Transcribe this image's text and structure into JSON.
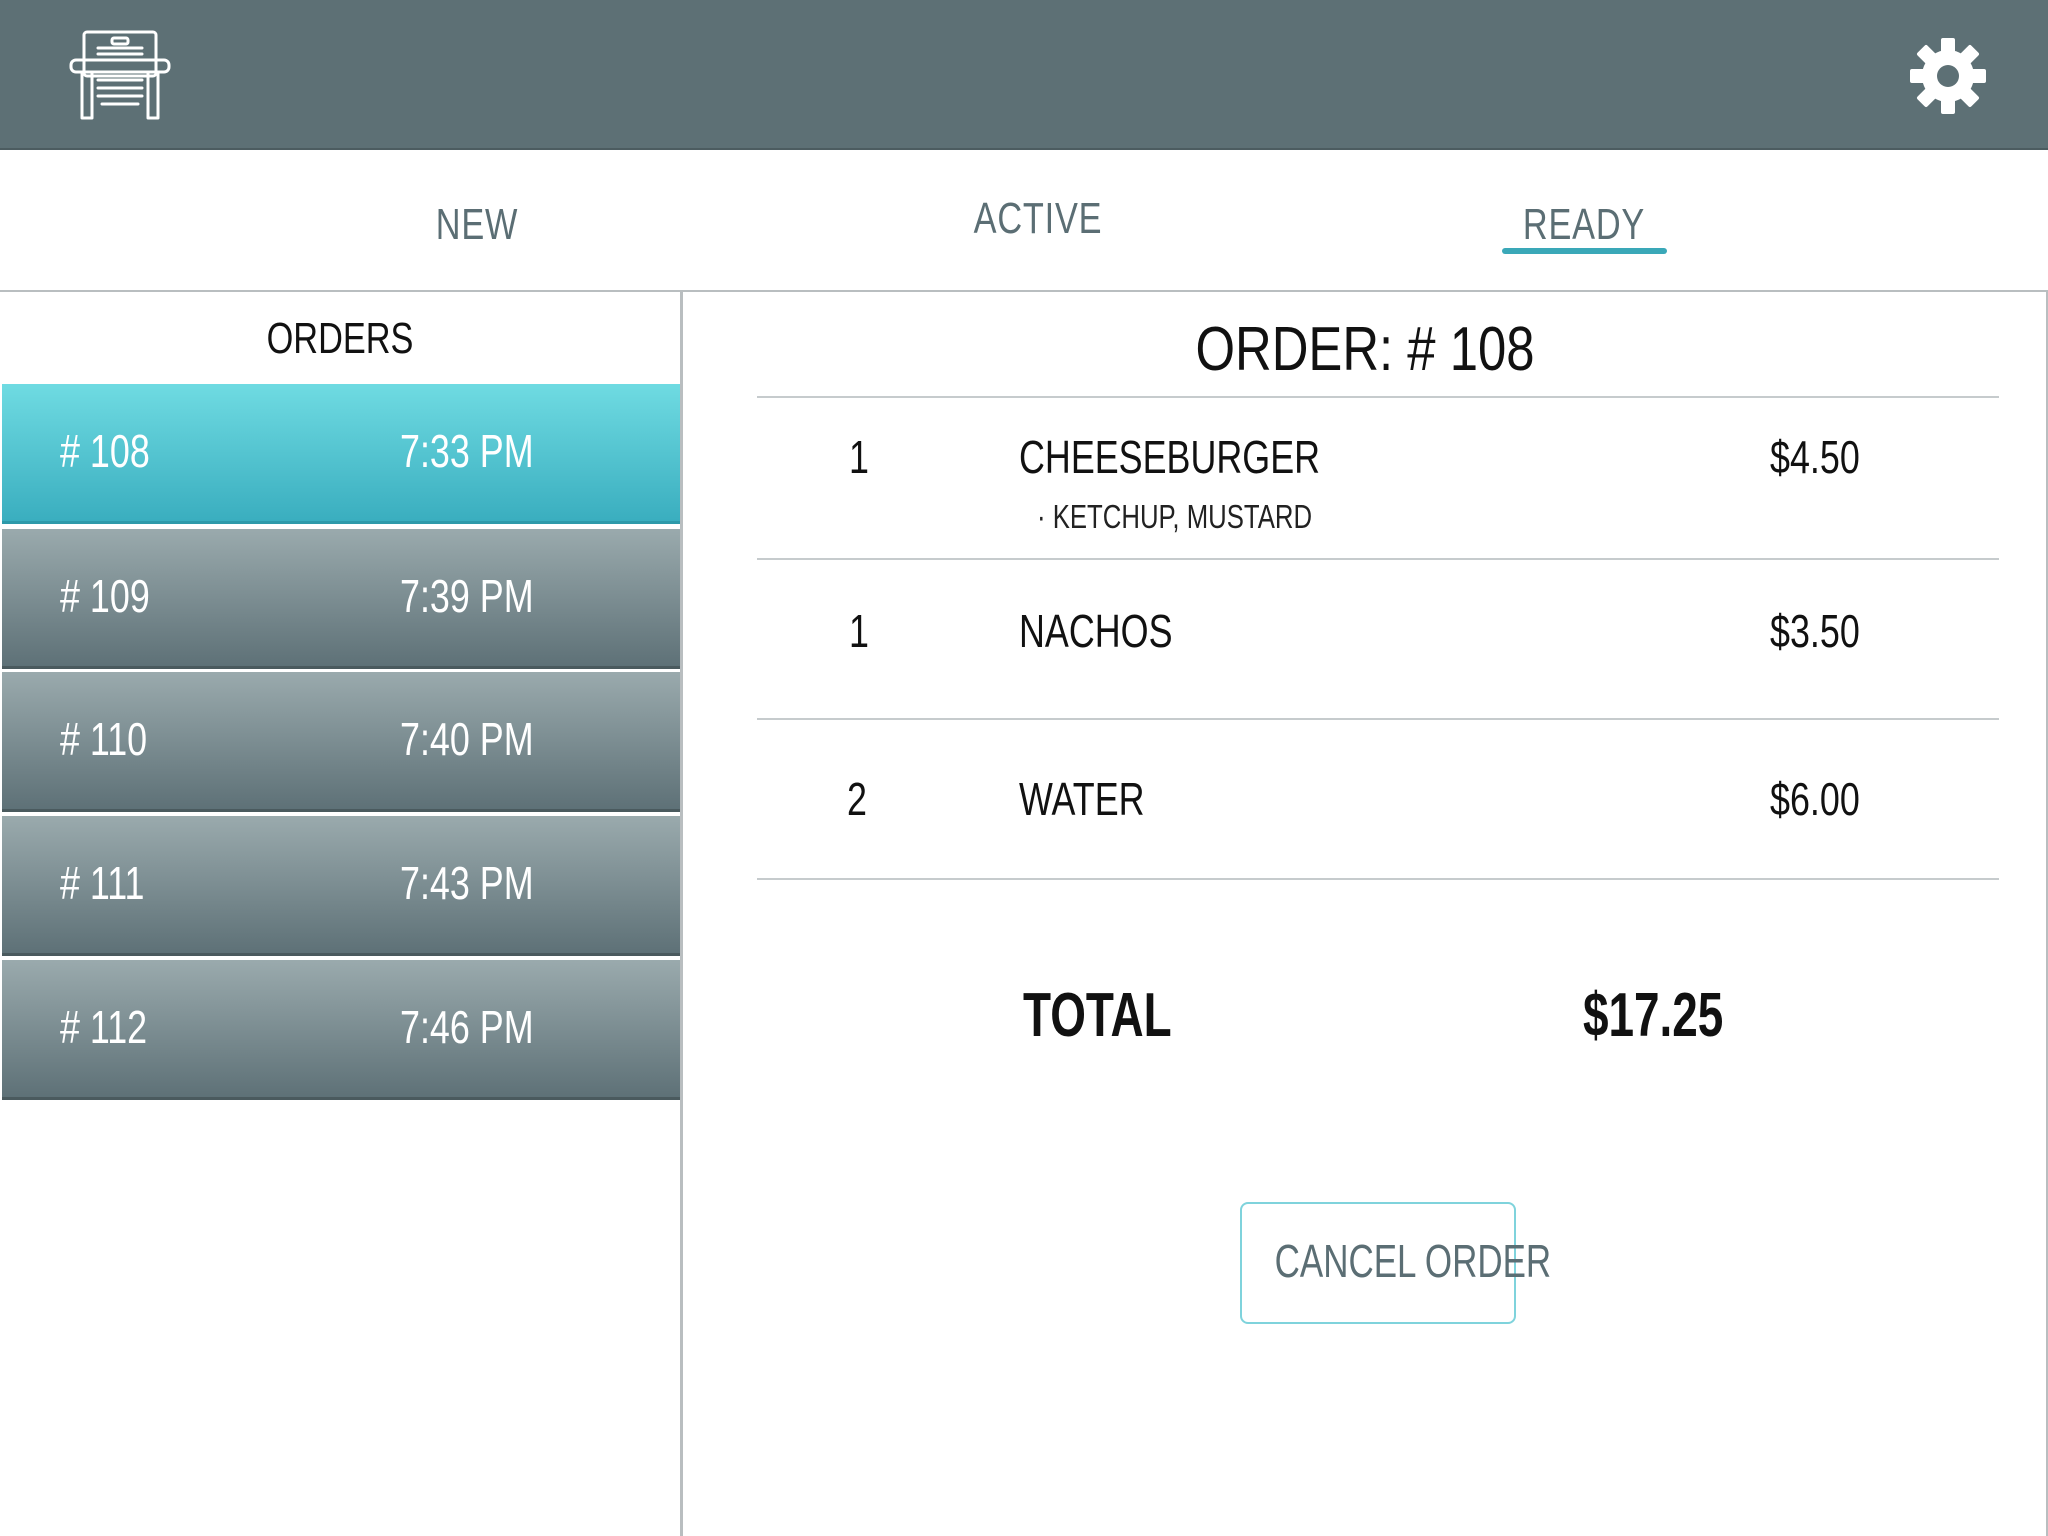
{
  "header": {
    "logo_icon": "register-icon",
    "settings_icon": "gear-icon",
    "bg_color": "#5d7075"
  },
  "tabs": [
    {
      "label": "NEW"
    },
    {
      "label": "ACTIVE"
    },
    {
      "label": "READY",
      "selected": true
    }
  ],
  "orders": {
    "title": "ORDERS",
    "rows": [
      {
        "number": "# 108",
        "time": "7:33 PM",
        "selected": true
      },
      {
        "number": "# 109",
        "time": "7:39 PM"
      },
      {
        "number": "# 110",
        "time": "7:40 PM"
      },
      {
        "number": "# 111",
        "time": "7:43 PM"
      },
      {
        "number": "# 112",
        "time": "7:46 PM"
      }
    ]
  },
  "detail": {
    "title": "ORDER:  # 108",
    "items": [
      {
        "qty": "1",
        "name": "CHEESEBURGER",
        "price": "$4.50",
        "modifier": "·  KETCHUP, MUSTARD"
      },
      {
        "qty": "1",
        "name": "NACHOS",
        "price": "$3.50"
      },
      {
        "qty": "2",
        "name": "WATER",
        "price": "$6.00"
      }
    ],
    "total_label": "TOTAL",
    "total_value": "$17.25",
    "cancel_label": "CANCEL ORDER"
  },
  "colors": {
    "accent": "#3aa8b8",
    "selected_row": "#4cc4cf",
    "row": "#6f8287"
  }
}
